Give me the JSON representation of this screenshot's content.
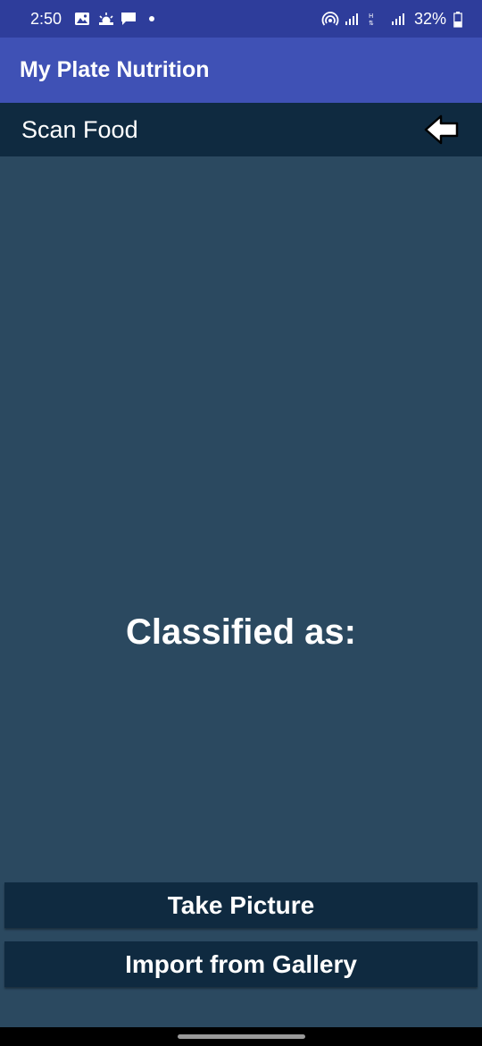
{
  "status_bar": {
    "time": "2:50",
    "battery": "32%",
    "icons": [
      "gallery-icon",
      "weather-icon",
      "message-icon",
      "notification-dot",
      "hotspot-icon",
      "signal-icon",
      "data-icon",
      "signal-icon",
      "battery-icon"
    ]
  },
  "app_bar": {
    "title": "My Plate Nutrition",
    "color": "#3f51b5"
  },
  "sub_header": {
    "title": "Scan Food",
    "back_icon": "back-arrow-icon"
  },
  "content": {
    "classified_label": "Classified as:"
  },
  "buttons": {
    "take_picture": "Take Picture",
    "import_gallery": "Import from Gallery"
  },
  "colors": {
    "background": "#2b4960",
    "dark": "#0f2a40",
    "status_bar": "#2e3d9b"
  }
}
